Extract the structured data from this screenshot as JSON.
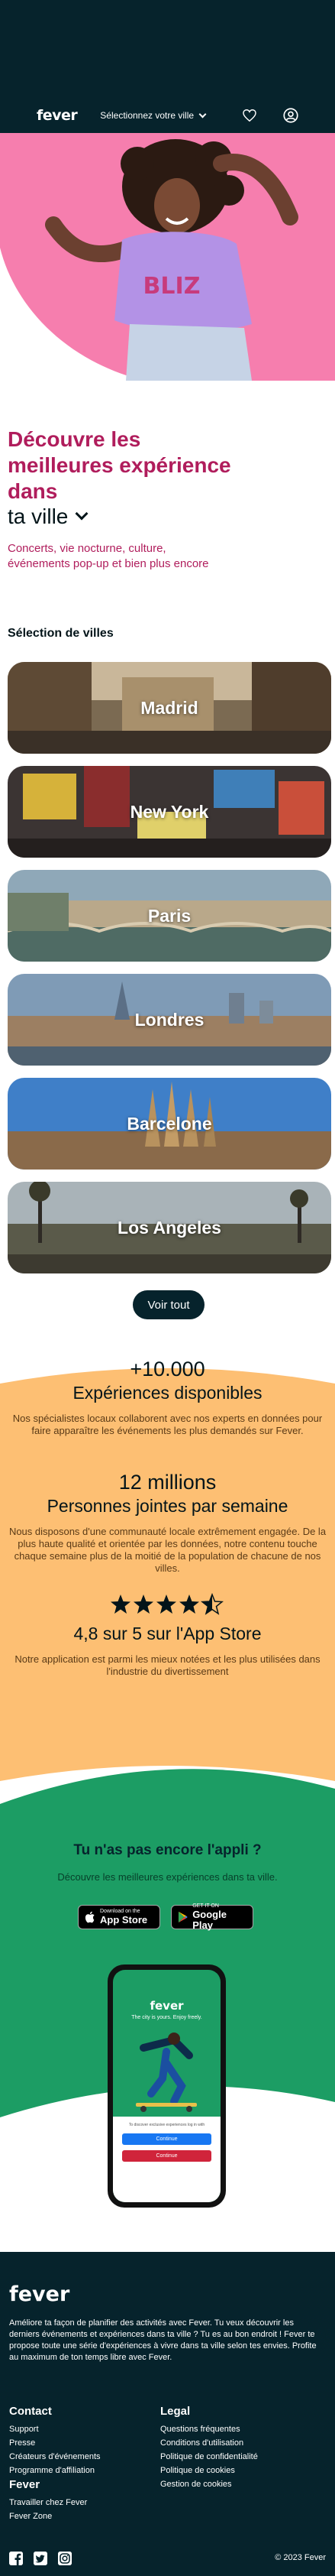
{
  "header": {
    "logo": "fever",
    "city_selector": "Sélectionnez votre ville",
    "icons": [
      "heart-icon",
      "user-icon"
    ]
  },
  "hero": {
    "headline": "Découvre les meilleures expérience dans",
    "city_label": "ta ville",
    "subtitle": "Concerts, vie nocturne, culture, événements pop-up et bien plus encore"
  },
  "cities_section": {
    "title": "Sélection de villes",
    "cities": [
      {
        "name": "Madrid"
      },
      {
        "name": "New York"
      },
      {
        "name": "Paris"
      },
      {
        "name": "Londres"
      },
      {
        "name": "Barcelone"
      },
      {
        "name": "Los Angeles"
      }
    ],
    "see_all": "Voir tout"
  },
  "stats": [
    {
      "number": "+10.000",
      "label": "Expériences disponibles",
      "description": "Nos spécialistes locaux collaborent avec nos experts en données pour faire apparaître les événements les plus demandés sur Fever."
    },
    {
      "number": "12 millions",
      "label": "Personnes jointes par semaine",
      "description": "Nous disposons d'une communauté locale extrêmement engagée. De la plus haute qualité et orientée par les données, notre contenu touche chaque semaine plus de la moitié de la population de chacune de nos villes."
    },
    {
      "rating_stars": 4.5,
      "label": "4,8 sur 5 sur l'App Store",
      "description": "Notre application est parmi les mieux notées et les plus utilisées dans l'industrie du divertissement"
    }
  ],
  "app_promo": {
    "title": "Tu n'as pas encore l'appli ?",
    "subtitle": "Découvre les meilleures expériences dans ta ville.",
    "app_store": {
      "small": "Download on the",
      "big": "App Store"
    },
    "google_play": {
      "small": "GET IT ON",
      "big": "Google Play"
    },
    "phone": {
      "logo": "fever",
      "tagline": "The city is yours. Enjoy freely.",
      "caption": "To discover exclusive experiences log in with",
      "facebook_button": "Continue",
      "email_button": "Continue"
    }
  },
  "footer": {
    "logo": "fever",
    "about": "Améliore ta façon de planifier des activités avec Fever. Tu veux découvrir les derniers événements et expériences dans ta ville ? Tu es au bon endroit ! Fever te propose toute une série d'expériences à vivre dans ta ville selon tes envies. Profite au maximum de ton temps libre avec Fever.",
    "contact": {
      "title": "Contact",
      "links": [
        "Support",
        "Presse",
        "Créateurs d'événements",
        "Programme d'affiliation"
      ]
    },
    "legal": {
      "title": "Legal",
      "links": [
        "Questions fréquentes",
        "Conditions d'utilisation",
        "Politique de confidentialité",
        "Politique de cookies",
        "Gestion de cookies"
      ]
    },
    "fever": {
      "title": "Fever",
      "links": [
        "Travailler chez Fever",
        "Fever Zone"
      ]
    },
    "social_icons": [
      "facebook-icon",
      "twitter-icon",
      "instagram-icon"
    ],
    "copyright": "© 2023 Fever"
  },
  "colors": {
    "dark": "#06232c",
    "accent": "#b01d5c",
    "pink": "#f67eae",
    "orange": "#fdbf73",
    "green": "#1c9d64"
  }
}
